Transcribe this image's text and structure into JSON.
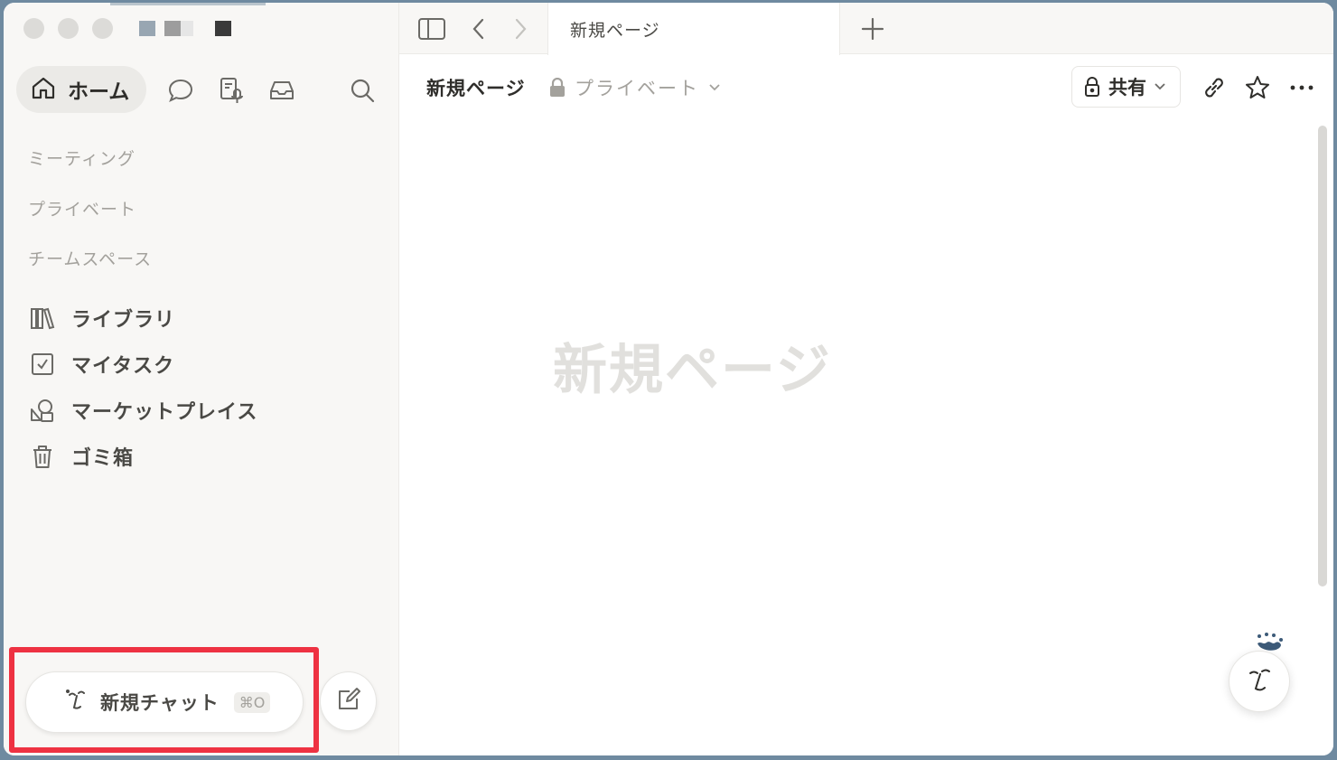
{
  "sidebar": {
    "home_label": "ホーム",
    "sections": [
      {
        "label": "ミーティング"
      },
      {
        "label": "プライベート"
      },
      {
        "label": "チームスペース"
      }
    ],
    "items": [
      {
        "label": "ライブラリ",
        "icon": "library-icon"
      },
      {
        "label": "マイタスク",
        "icon": "checkbox-icon"
      },
      {
        "label": "マーケットプレイス",
        "icon": "marketplace-icon"
      },
      {
        "label": "ゴミ箱",
        "icon": "trash-icon"
      }
    ],
    "new_chat_label": "新規チャット",
    "new_chat_shortcut": "⌘O"
  },
  "tabs": [
    {
      "label": "新規ページ"
    }
  ],
  "header": {
    "page_title": "新規ページ",
    "visibility": "プライベート",
    "share_label": "共有"
  },
  "page": {
    "placeholder_title": "新規ページ"
  },
  "colors": {
    "highlight": "#ee3242",
    "sidebar_bg": "#f8f7f5",
    "desktop_bg": "#6f8aa0"
  }
}
